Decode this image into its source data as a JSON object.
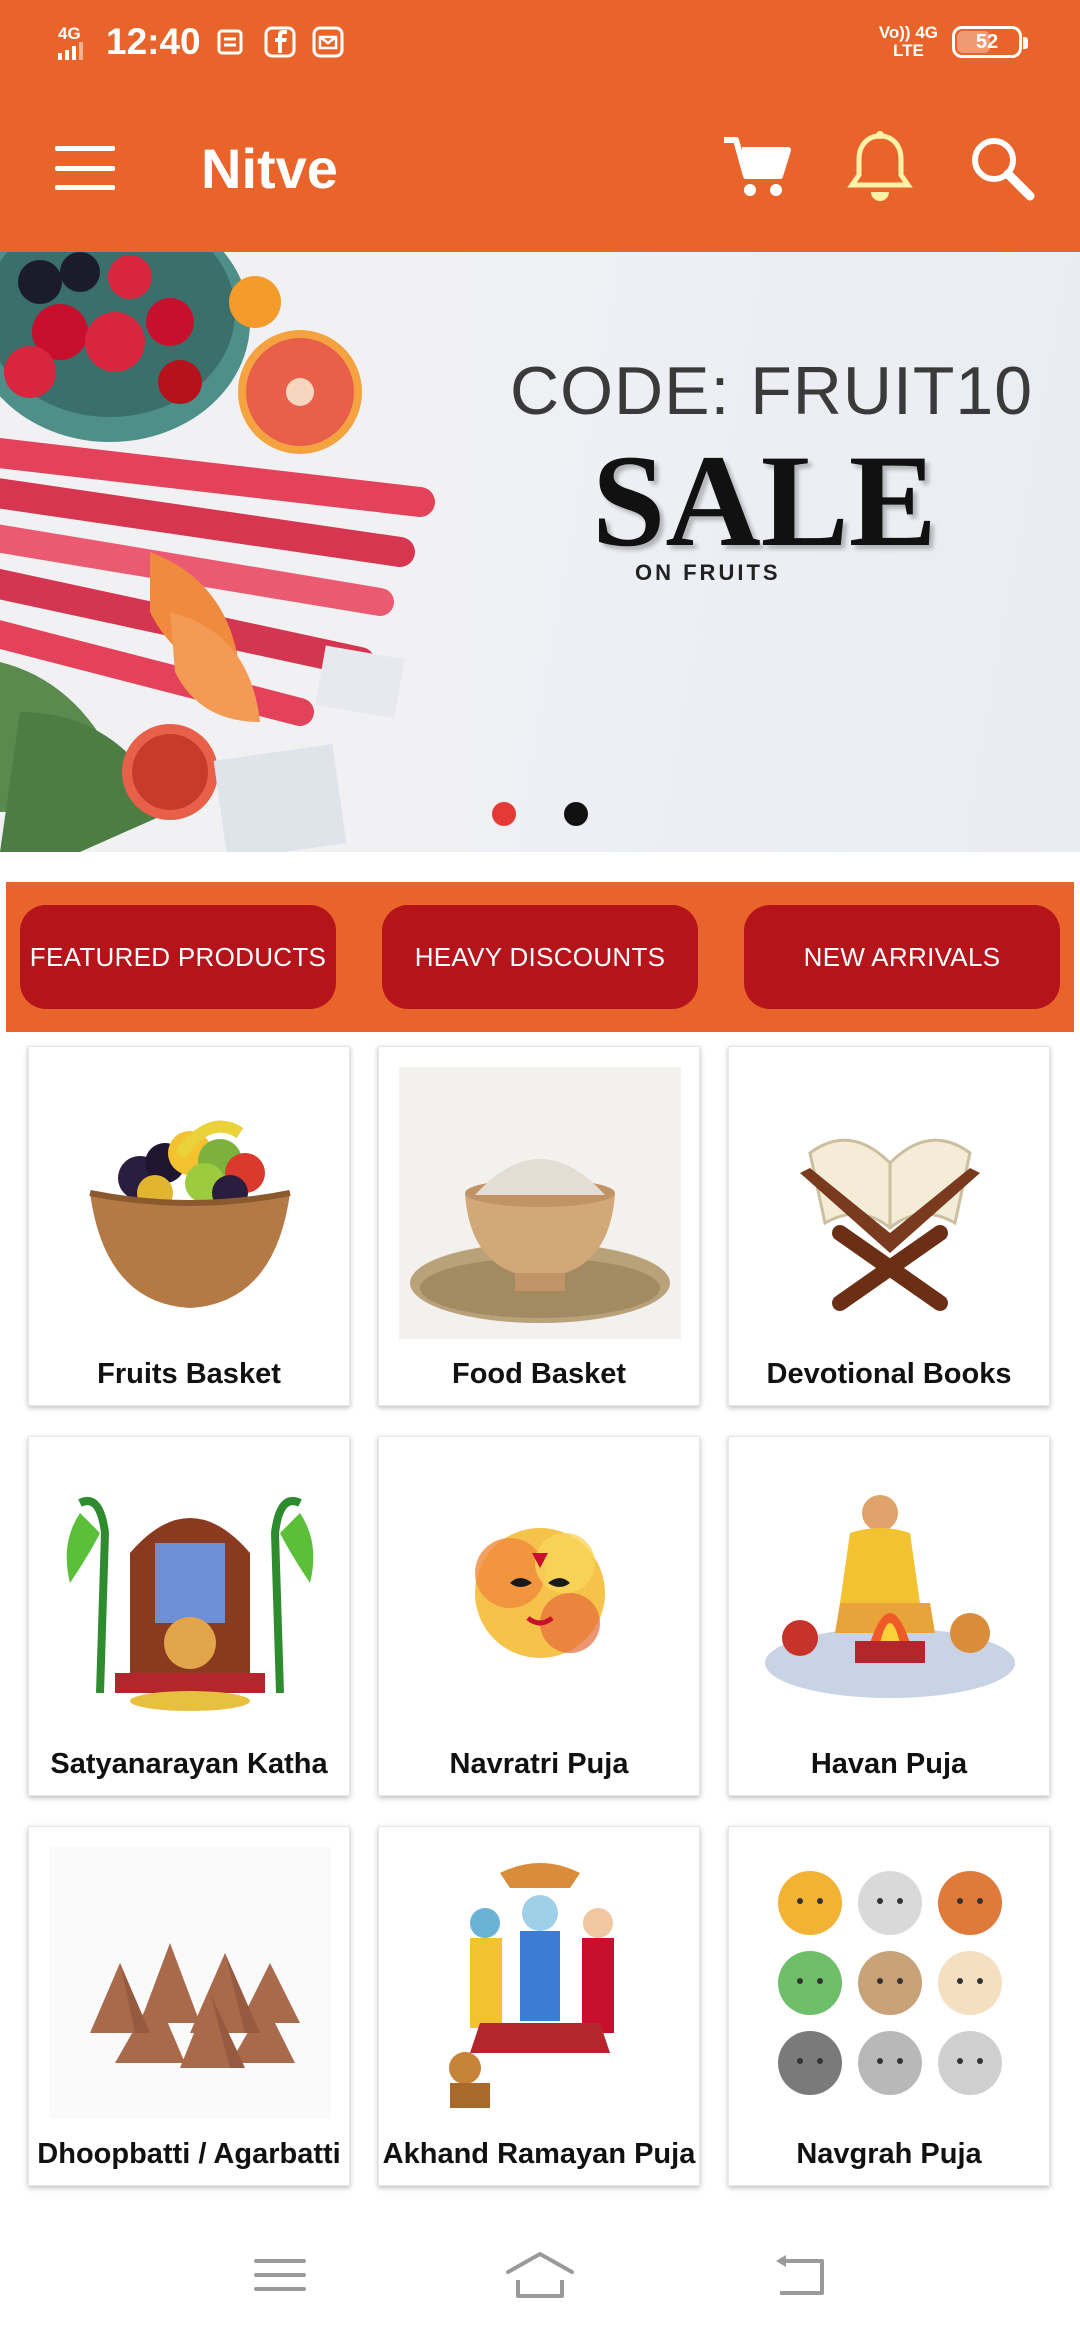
{
  "status_bar": {
    "network": "4G",
    "time": "12:40",
    "volte_top": "Vo)) 4G",
    "volte_bottom": "LTE",
    "battery": "52",
    "battery_level": 0.52
  },
  "app_bar": {
    "title": "Nitve"
  },
  "banner": {
    "code": "CODE: FRUIT10",
    "headline": "SALE",
    "subline": "ON FRUITS",
    "slide_count": 2,
    "active_slide": 0
  },
  "filters": [
    {
      "label": "FEATURED PRODUCTS"
    },
    {
      "label": "HEAVY DISCOUNTS"
    },
    {
      "label": "NEW ARRIVALS"
    }
  ],
  "categories": [
    {
      "label": "Fruits Basket",
      "icon": "fruit-basket-image"
    },
    {
      "label": "Food Basket",
      "icon": "flour-bowl-image"
    },
    {
      "label": "Devotional Books",
      "icon": "book-stand-image"
    },
    {
      "label": "Satyanarayan Katha",
      "icon": "puja-altar-image"
    },
    {
      "label": "Navratri Puja",
      "icon": "durga-face-image"
    },
    {
      "label": "Havan Puja",
      "icon": "havan-fire-image"
    },
    {
      "label": "Dhoopbatti / Agarbatti",
      "icon": "dhoop-cones-image"
    },
    {
      "label": "Akhand Ramayan Puja",
      "icon": "ramayan-deities-image"
    },
    {
      "label": "Navgrah Puja",
      "icon": "navgrah-planets-image"
    }
  ],
  "colors": {
    "primary": "#e8642a",
    "chip": "#b5141b",
    "dot_active": "#e53935"
  }
}
